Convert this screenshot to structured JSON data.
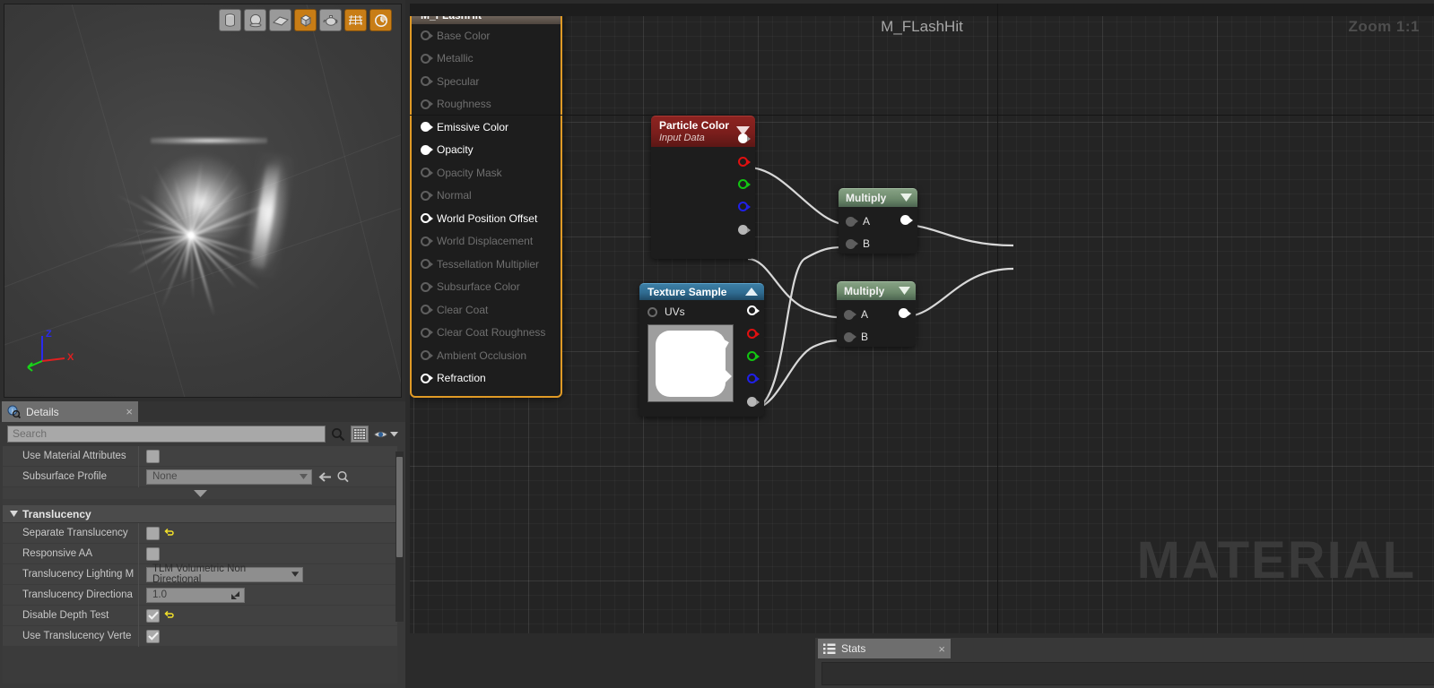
{
  "viewport": {
    "name": "material-preview-viewport",
    "toolbar": [
      {
        "name": "preview-cylinder",
        "icon": "cylinder-icon",
        "active": false
      },
      {
        "name": "preview-sphere",
        "icon": "sphere-icon",
        "active": false
      },
      {
        "name": "preview-plane",
        "icon": "plane-icon",
        "active": false
      },
      {
        "name": "preview-cube",
        "icon": "cube-icon",
        "active": true
      },
      {
        "name": "preview-teapot",
        "icon": "teapot-icon",
        "active": false
      },
      {
        "name": "toggle-grid",
        "icon": "grid-icon",
        "active": true
      },
      {
        "name": "toggle-realtime",
        "icon": "realtime-clock-icon",
        "active": true
      }
    ],
    "axes": {
      "z": "Z",
      "x": "X",
      "y": ""
    }
  },
  "details": {
    "tab_label": "Details",
    "tab_close": "×",
    "search": {
      "value": "",
      "placeholder": "Search"
    },
    "rows_top": [
      {
        "label": "Use Material Attributes",
        "type": "checkbox",
        "checked": false,
        "reset": false
      },
      {
        "label": "Subsurface Profile",
        "type": "combo",
        "value": "None",
        "reset": false
      }
    ],
    "expander_glyph": "▼",
    "section": {
      "title": "Translucency",
      "collapse_glyph": "◢",
      "rows": [
        {
          "label": "Separate Translucency",
          "type": "checkbox",
          "checked": false,
          "reset": true
        },
        {
          "label": "Responsive AA",
          "type": "checkbox",
          "checked": false,
          "reset": false
        },
        {
          "label": "Translucency Lighting M",
          "type": "combo",
          "value": "TLM Volumetric Non Directional",
          "reset": false
        },
        {
          "label": "Translucency Directiona",
          "type": "number",
          "value": "1.0",
          "reset": false
        },
        {
          "label": "Disable Depth Test",
          "type": "checkbox",
          "checked": true,
          "reset": true
        },
        {
          "label": "Use Translucency Verte",
          "type": "checkbox",
          "checked": true,
          "reset": false
        }
      ]
    }
  },
  "graph": {
    "title": "M_FLashHit",
    "zoom_label": "Zoom 1:1",
    "watermark": "MATERIAL",
    "nodes": {
      "particle_color": {
        "title": "Particle Color",
        "subtitle": "Input Data",
        "chevron": "▼",
        "outputs": [
          "",
          "",
          "",
          "",
          ""
        ]
      },
      "texture_sample": {
        "title": "Texture Sample",
        "chevron": "▲",
        "input_label": "UVs",
        "outputs": [
          "",
          "",
          "",
          "",
          ""
        ]
      },
      "multiply_1": {
        "title": "Multiply",
        "chevron": "▼",
        "inputs": [
          "A",
          "B"
        ]
      },
      "multiply_2": {
        "title": "Multiply",
        "chevron": "▼",
        "inputs": [
          "A",
          "B"
        ]
      },
      "output": {
        "title": "M_FLashHit",
        "pins": [
          {
            "label": "Base Color",
            "connected": false
          },
          {
            "label": "Metallic",
            "connected": false
          },
          {
            "label": "Specular",
            "connected": false
          },
          {
            "label": "Roughness",
            "connected": false
          },
          {
            "label": "Emissive Color",
            "connected": true
          },
          {
            "label": "Opacity",
            "connected": true
          },
          {
            "label": "Opacity Mask",
            "connected": false
          },
          {
            "label": "Normal",
            "connected": false
          },
          {
            "label": "World Position Offset",
            "connected": false,
            "enabled": true
          },
          {
            "label": "World Displacement",
            "connected": false
          },
          {
            "label": "Tessellation Multiplier",
            "connected": false
          },
          {
            "label": "Subsurface Color",
            "connected": false
          },
          {
            "label": "Clear Coat",
            "connected": false
          },
          {
            "label": "Clear Coat Roughness",
            "connected": false
          },
          {
            "label": "Ambient Occlusion",
            "connected": false
          },
          {
            "label": "Refraction",
            "connected": false,
            "enabled": true
          }
        ]
      }
    }
  },
  "stats": {
    "tab_label": "Stats",
    "tab_close": "×"
  },
  "colors": {
    "accent_orange": "#e09a26",
    "particle_header": "#7a1e1c",
    "texture_header": "#2f6b90",
    "multiply_header": "#6d8a6c",
    "pin_red": "#e01010",
    "pin_green": "#12c412",
    "pin_blue": "#2020e8",
    "reset_yellow": "#f2e02a"
  }
}
